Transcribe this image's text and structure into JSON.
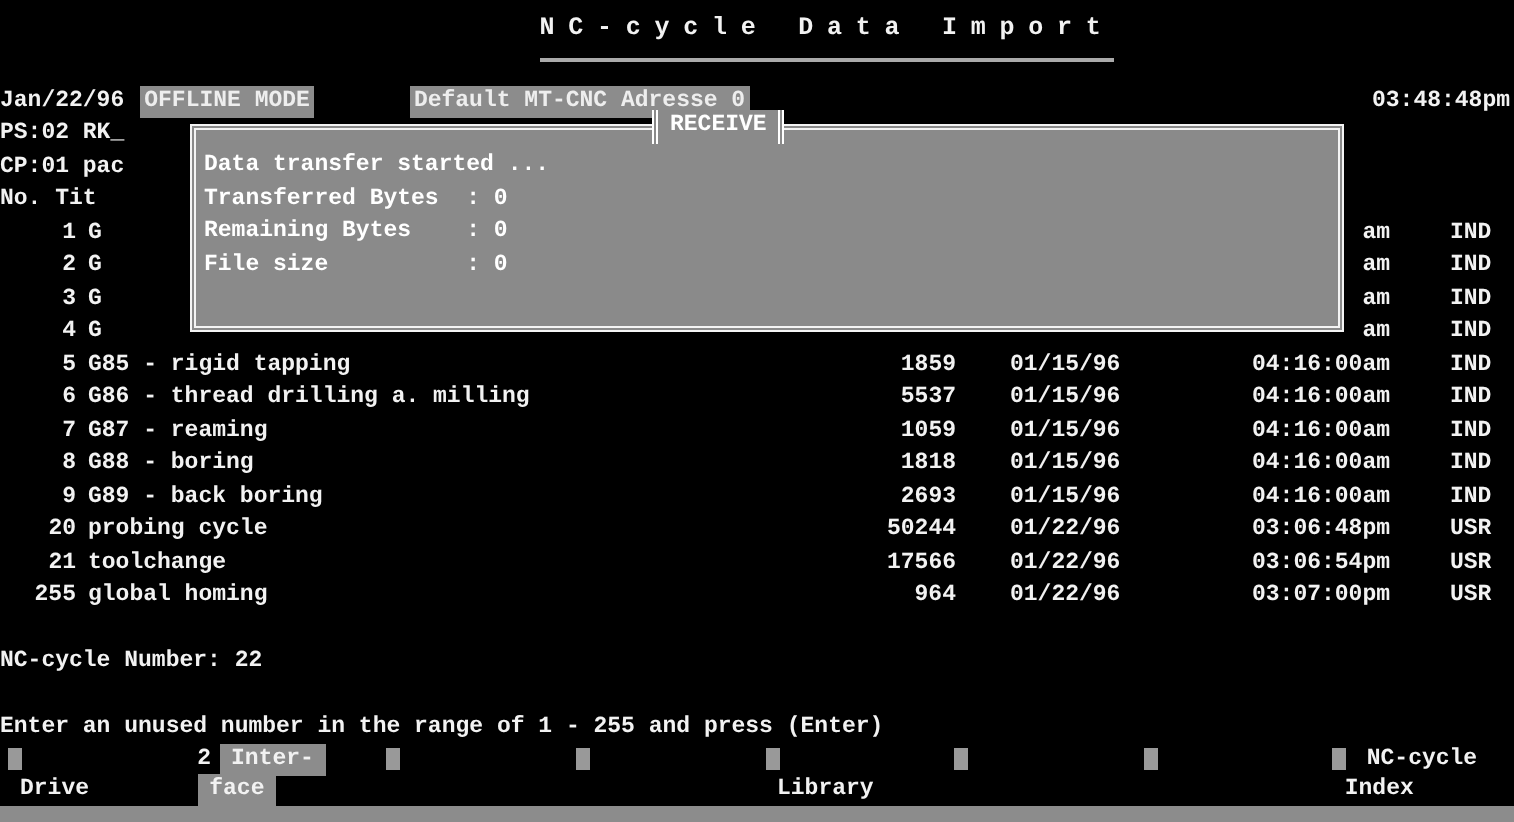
{
  "title": "NC-cycle Data Import",
  "header": {
    "date": "Jan/22/96",
    "mode": "OFFLINE MODE",
    "address": "Default MT-CNC Adresse 0",
    "time": "03:48:48pm"
  },
  "info_lines": [
    "PS:02 RK_",
    "CP:01 pac",
    "No. Tit"
  ],
  "rows": [
    {
      "no": "1",
      "title": "G",
      "size": "",
      "date": "",
      "time": "am",
      "type": "IND"
    },
    {
      "no": "2",
      "title": "G",
      "size": "",
      "date": "",
      "time": "am",
      "type": "IND"
    },
    {
      "no": "3",
      "title": "G",
      "size": "",
      "date": "",
      "time": "am",
      "type": "IND"
    },
    {
      "no": "4",
      "title": "G",
      "size": "",
      "date": "",
      "time": "am",
      "type": "IND"
    },
    {
      "no": "5",
      "title": "G85 - rigid tapping",
      "size": "1859",
      "date": "01/15/96",
      "time": "04:16:00am",
      "type": "IND"
    },
    {
      "no": "6",
      "title": "G86 - thread drilling a. milling",
      "size": "5537",
      "date": "01/15/96",
      "time": "04:16:00am",
      "type": "IND"
    },
    {
      "no": "7",
      "title": "G87 - reaming",
      "size": "1059",
      "date": "01/15/96",
      "time": "04:16:00am",
      "type": "IND"
    },
    {
      "no": "8",
      "title": "G88 - boring",
      "size": "1818",
      "date": "01/15/96",
      "time": "04:16:00am",
      "type": "IND"
    },
    {
      "no": "9",
      "title": "G89 - back boring",
      "size": "2693",
      "date": "01/15/96",
      "time": "04:16:00am",
      "type": "IND"
    },
    {
      "no": "20",
      "title": "probing cycle",
      "size": "50244",
      "date": "01/22/96",
      "time": "03:06:48pm",
      "type": "USR"
    },
    {
      "no": "21",
      "title": "toolchange",
      "size": "17566",
      "date": "01/22/96",
      "time": "03:06:54pm",
      "type": "USR"
    },
    {
      "no": "255",
      "title": "global homing",
      "size": "964",
      "date": "01/22/96",
      "time": "03:07:00pm",
      "type": "USR"
    }
  ],
  "dialog": {
    "title": "RECEIVE",
    "lines": [
      "Data transfer started ...",
      "Transferred Bytes  : 0",
      "Remaining Bytes    : 0",
      "File size          : 0"
    ]
  },
  "number_prompt": "NC-cycle Number: 22",
  "instruction": "Enter an unused number in the range of 1 - 255 and press (Enter)",
  "function_keys": [
    {
      "lower": "Drive",
      "selected": false
    },
    {
      "key": "2",
      "upper": "Inter-",
      "lower": "face",
      "selected": true
    },
    {
      "selected": false
    },
    {
      "selected": false
    },
    {
      "lower": "Library",
      "selected": false
    },
    {
      "selected": false
    },
    {
      "selected": false
    },
    {
      "upper": "NC-cycle",
      "lower": "Index",
      "selected": false
    }
  ]
}
